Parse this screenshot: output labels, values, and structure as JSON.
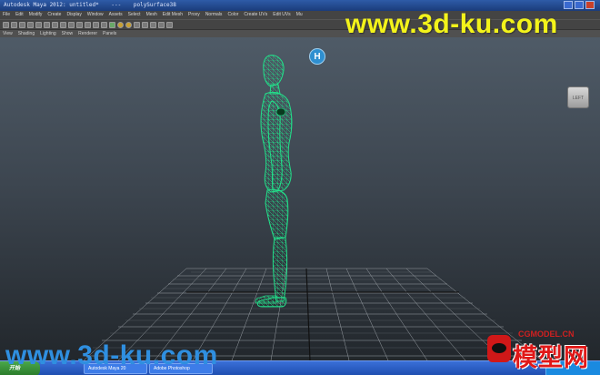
{
  "window": {
    "app_title": "Autodesk Maya 2012: untitled*",
    "separator": "---",
    "object_name": "polySurface38"
  },
  "menubar": {
    "items": [
      "File",
      "Edit",
      "Modify",
      "Create",
      "Display",
      "Window",
      "Assets",
      "Select",
      "Mesh",
      "Edit Mesh",
      "Proxy",
      "Normals",
      "Color",
      "Create UVs",
      "Edit UVs",
      "Mu"
    ]
  },
  "panel_menu": {
    "items": [
      "View",
      "Shading",
      "Lighting",
      "Show",
      "Renderer",
      "Panels"
    ]
  },
  "hotbox_badge": "H",
  "viewcube_label": "LEFT",
  "watermark": {
    "top": "www.3d-ku.com",
    "bottom": "www.3d-ku.com"
  },
  "logo": {
    "small": "CGMODEL.CN",
    "big": "模型网"
  },
  "taskbar": {
    "start": "开始",
    "items": [
      "Autodesk Maya 20",
      "Adobe Photoshop"
    ]
  },
  "colors": {
    "wireframe": "#22e08a",
    "grid": "#9aa0a6",
    "watermark_top": "#f3f31a",
    "watermark_bottom": "#2f8fe0"
  }
}
